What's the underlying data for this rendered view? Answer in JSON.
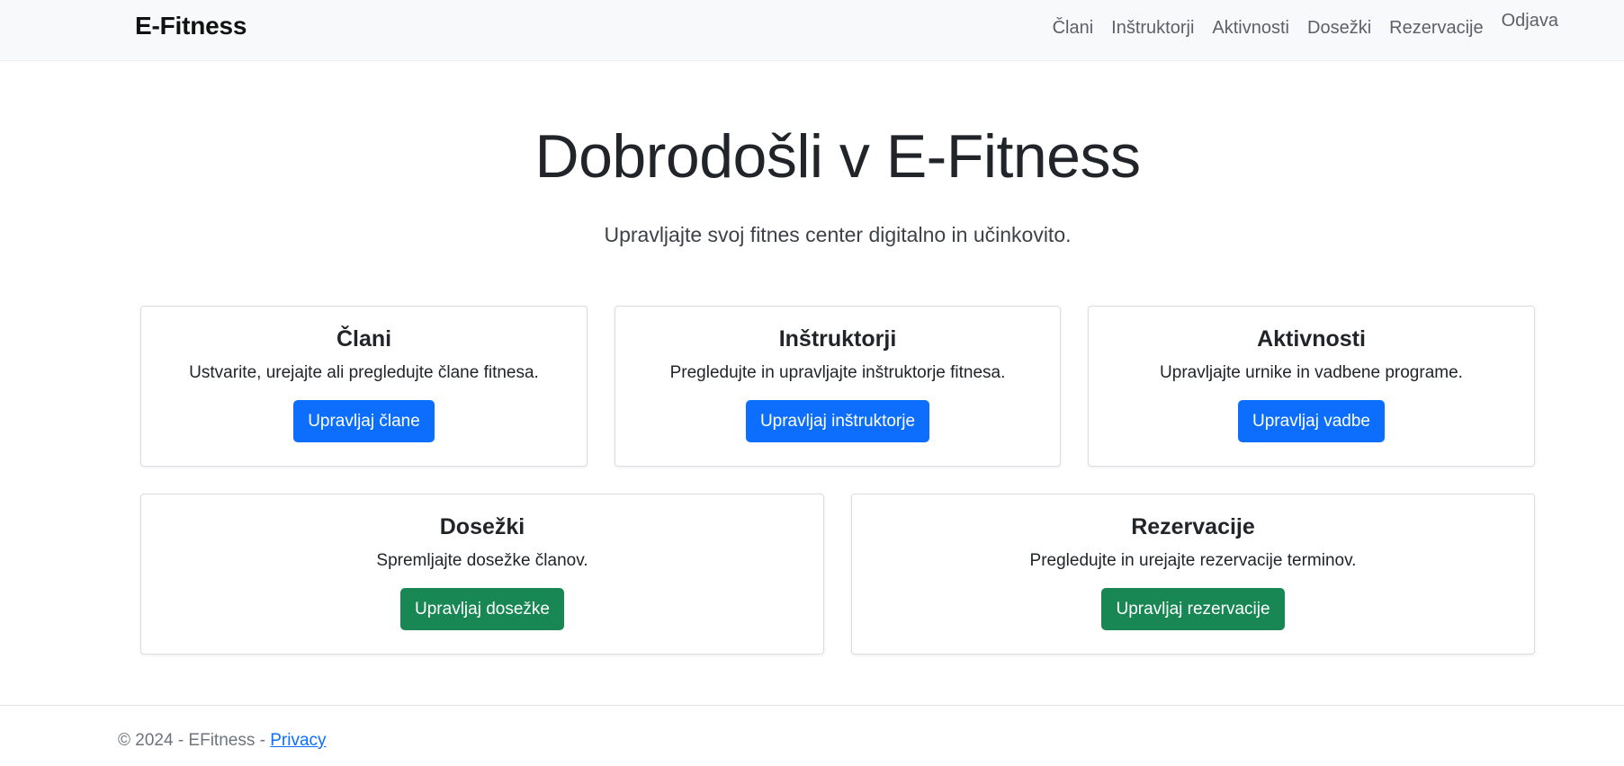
{
  "navbar": {
    "brand": "E-Fitness",
    "links": [
      {
        "label": "Člani"
      },
      {
        "label": "Inštruktorji"
      },
      {
        "label": "Aktivnosti"
      },
      {
        "label": "Dosežki"
      },
      {
        "label": "Rezervacije"
      }
    ],
    "logout": "Odjava"
  },
  "hero": {
    "title": "Dobrodošli v E-Fitness",
    "subtitle": "Upravljajte svoj fitnes center digitalno in učinkovito."
  },
  "cards": [
    {
      "title": "Člani",
      "text": "Ustvarite, urejajte ali pregledujte člane fitnesa.",
      "button": "Upravljaj člane"
    },
    {
      "title": "Inštruktorji",
      "text": "Pregledujte in upravljajte inštruktorje fitnesa.",
      "button": "Upravljaj inštruktorje"
    },
    {
      "title": "Aktivnosti",
      "text": "Upravljajte urnike in vadbene programe.",
      "button": "Upravljaj vadbe"
    },
    {
      "title": "Dosežki",
      "text": "Spremljajte dosežke članov.",
      "button": "Upravljaj dosežke"
    },
    {
      "title": "Rezervacije",
      "text": "Pregledujte in urejajte rezervacije terminov.",
      "button": "Upravljaj rezervacije"
    }
  ],
  "colors": {
    "primary": "#0d6efd",
    "success": "#198754",
    "navbar_bg": "#f8f9fa"
  },
  "footer": {
    "text": "© 2024 - EFitness - ",
    "link": "Privacy"
  }
}
